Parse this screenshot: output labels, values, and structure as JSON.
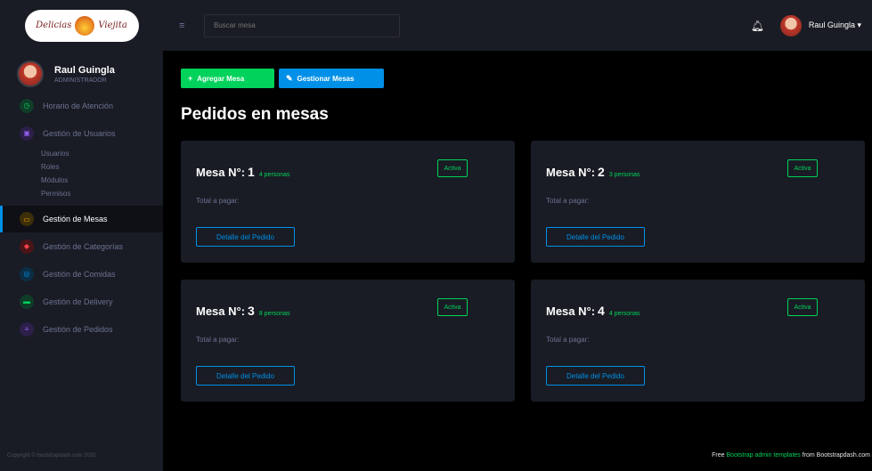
{
  "brand": {
    "left": "Delicias",
    "right": "Viejita",
    "logo_icon": "flame-icon"
  },
  "profile": {
    "name": "Raul Guingla",
    "role": "ADMINISTRADOR"
  },
  "sidebar": {
    "items": [
      {
        "label": "Horario de Atención",
        "icon": "clock-icon",
        "color": "#00d25b"
      },
      {
        "label": "Gestión de Usuarios",
        "icon": "user-icon",
        "color": "#8f5fe8"
      }
    ],
    "subitems": [
      "Usuarios",
      "Roles",
      "Módulos",
      "Permisos"
    ],
    "active": {
      "label": "Gestión de Mesas",
      "icon": "table-icon",
      "color": "#ffab00"
    },
    "items_after": [
      {
        "label": "Gestión de Categorías",
        "icon": "tag-icon",
        "color": "#fc424a"
      },
      {
        "label": "Gestión de Comidas",
        "icon": "food-icon",
        "color": "#0090e7"
      },
      {
        "label": "Gestión de Delivery",
        "icon": "truck-icon",
        "color": "#00d25b"
      },
      {
        "label": "Gestión de Pedidos",
        "icon": "list-icon",
        "color": "#8f5fe8"
      }
    ],
    "footer": "Copyright © bootstrapdash.com 2020"
  },
  "topbar": {
    "search_placeholder": "Buscar mesa",
    "user_name": "Raul Guingla",
    "dropdown_caret": "▾"
  },
  "actions": {
    "add_label": "Agregar Mesa",
    "manage_label": "Gestionar Mesas"
  },
  "page": {
    "title": "Pedidos en mesas"
  },
  "tables": [
    {
      "title": "Mesa N°:",
      "number": "1",
      "people": "4 personas",
      "status": "Activa",
      "total_label": "Total a pagar:",
      "detail_label": "Detalle del Pedido"
    },
    {
      "title": "Mesa N°:",
      "number": "2",
      "people": "3 personas",
      "status": "Activa",
      "total_label": "Total a pagar:",
      "detail_label": "Detalle del Pedido"
    },
    {
      "title": "Mesa N°:",
      "number": "3",
      "people": "8 personas",
      "status": "Activa",
      "total_label": "Total a pagar:",
      "detail_label": "Detalle del Pedido"
    },
    {
      "title": "Mesa N°:",
      "number": "4",
      "people": "4 personas",
      "status": "Activa",
      "total_label": "Total a pagar:",
      "detail_label": "Detalle del Pedido"
    }
  ],
  "footer": {
    "prefix": "Free",
    "link": "Bootstrap admin templates",
    "suffix": "from Bootstrapdash.com"
  }
}
